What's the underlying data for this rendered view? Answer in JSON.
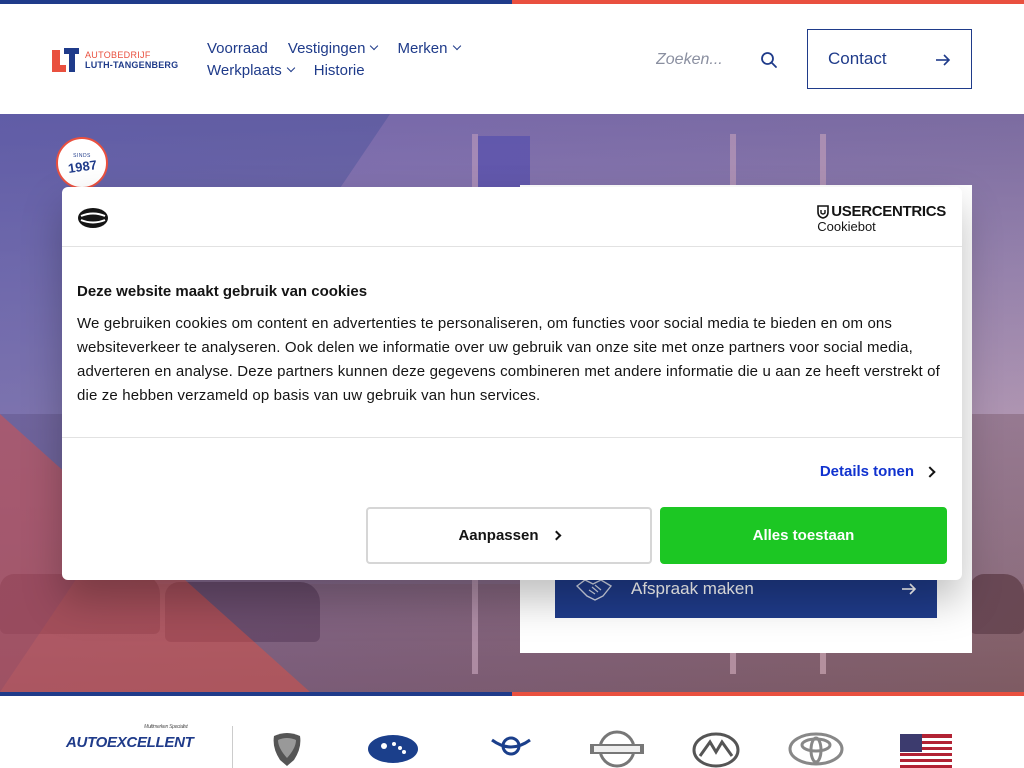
{
  "header": {
    "logo_line1": "AUTOBEDRIJF",
    "logo_line2": "LUTH-TANGENBERG",
    "nav": [
      {
        "label": "Voorraad"
      },
      {
        "label": "Vestigingen"
      },
      {
        "label": "Merken"
      },
      {
        "label": "Werkplaats"
      },
      {
        "label": "Historie"
      }
    ],
    "search_placeholder": "Zoeken...",
    "contact_label": "Contact"
  },
  "hero": {
    "badge_since": "SINDS",
    "badge_year": "1987",
    "afspraak_label": "Afspraak maken"
  },
  "brands": {
    "autoexcellent": "AUTOEXCELLENT",
    "autoexcellent_tagline": "Multimerken Specialist"
  },
  "cookie": {
    "brand_name": "USERCENTRICS",
    "brand_sub": "Cookiebot",
    "title": "Deze website maakt gebruik van cookies",
    "text": "We gebruiken cookies om content en advertenties te personaliseren, om functies voor social media te bieden en om ons websiteverkeer te analyseren. Ook delen we informatie over uw gebruik van onze site met onze partners voor social media, adverteren en analyse. Deze partners kunnen deze gegevens combineren met andere informatie die u aan ze heeft verstrekt of die ze hebben verzameld op basis van uw gebruik van hun services.",
    "details_label": "Details tonen",
    "customize_label": "Aanpassen",
    "allow_all_label": "Alles toestaan"
  },
  "colors": {
    "brand_blue": "#1f3b8a",
    "brand_red": "#e9503f",
    "allow_green": "#1cc723",
    "link_blue": "#1032cf"
  }
}
